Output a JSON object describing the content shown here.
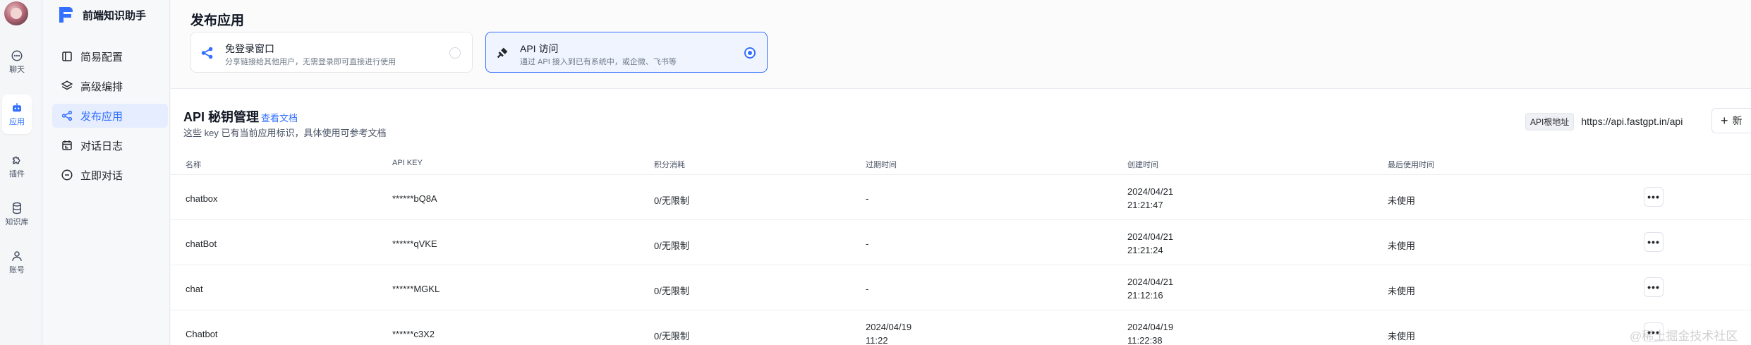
{
  "rail": {
    "items": [
      {
        "label": "聊天",
        "icon": "chat-bubble-icon",
        "active": false
      },
      {
        "label": "应用",
        "icon": "robot-icon",
        "active": true
      },
      {
        "label": "插件",
        "icon": "puzzle-icon",
        "active": false
      },
      {
        "label": "知识库",
        "icon": "database-icon",
        "active": false
      },
      {
        "label": "账号",
        "icon": "user-icon",
        "active": false
      }
    ]
  },
  "sidebar": {
    "app_name": "前端知识助手",
    "items": [
      {
        "label": "简易配置",
        "icon": "simple-config-icon"
      },
      {
        "label": "高级编排",
        "icon": "layers-icon"
      },
      {
        "label": "发布应用",
        "icon": "share-icon",
        "active": true
      },
      {
        "label": "对话日志",
        "icon": "calendar-log-icon"
      },
      {
        "label": "立即对话",
        "icon": "chat-icon"
      }
    ]
  },
  "publish": {
    "title": "发布应用",
    "cards": [
      {
        "title": "免登录窗口",
        "desc": "分享链接给其他用户，无需登录即可直接进行使用",
        "selected": false
      },
      {
        "title": "API 访问",
        "desc": "通过 API 接入到已有系统中，或企微、飞书等",
        "selected": true
      }
    ]
  },
  "api": {
    "title": "API 秘钥管理",
    "doc_link": "查看文档",
    "subtitle": "这些 key 已有当前应用标识，具体使用可参考文档",
    "base_label": "API根地址",
    "base_url": "https://api.fastgpt.in/api",
    "new_label": "新"
  },
  "table": {
    "headers": [
      "名称",
      "API KEY",
      "积分消耗",
      "过期时间",
      "创建时间",
      "最后使用时间"
    ],
    "rows": [
      {
        "name": "chatbox",
        "key": "******bQ8A",
        "usage": "0/无限制",
        "expire1": "-",
        "expire2": "",
        "created1": "2024/04/21",
        "created2": "21:21:47",
        "last_used": "未使用"
      },
      {
        "name": "chatBot",
        "key": "******qVKE",
        "usage": "0/无限制",
        "expire1": "-",
        "expire2": "",
        "created1": "2024/04/21",
        "created2": "21:21:24",
        "last_used": "未使用"
      },
      {
        "name": "chat",
        "key": "******MGKL",
        "usage": "0/无限制",
        "expire1": "-",
        "expire2": "",
        "created1": "2024/04/21",
        "created2": "21:12:16",
        "last_used": "未使用"
      },
      {
        "name": "Chatbot",
        "key": "******c3X2",
        "usage": "0/无限制",
        "expire1": "2024/04/19",
        "expire2": "11:22",
        "created1": "2024/04/19",
        "created2": "11:22:38",
        "last_used": "未使用"
      }
    ],
    "more_label": "•••"
  },
  "watermark": "@稀土掘金技术社区",
  "colors": {
    "accent": "#3370ff",
    "selected_bg": "#e5edff"
  }
}
